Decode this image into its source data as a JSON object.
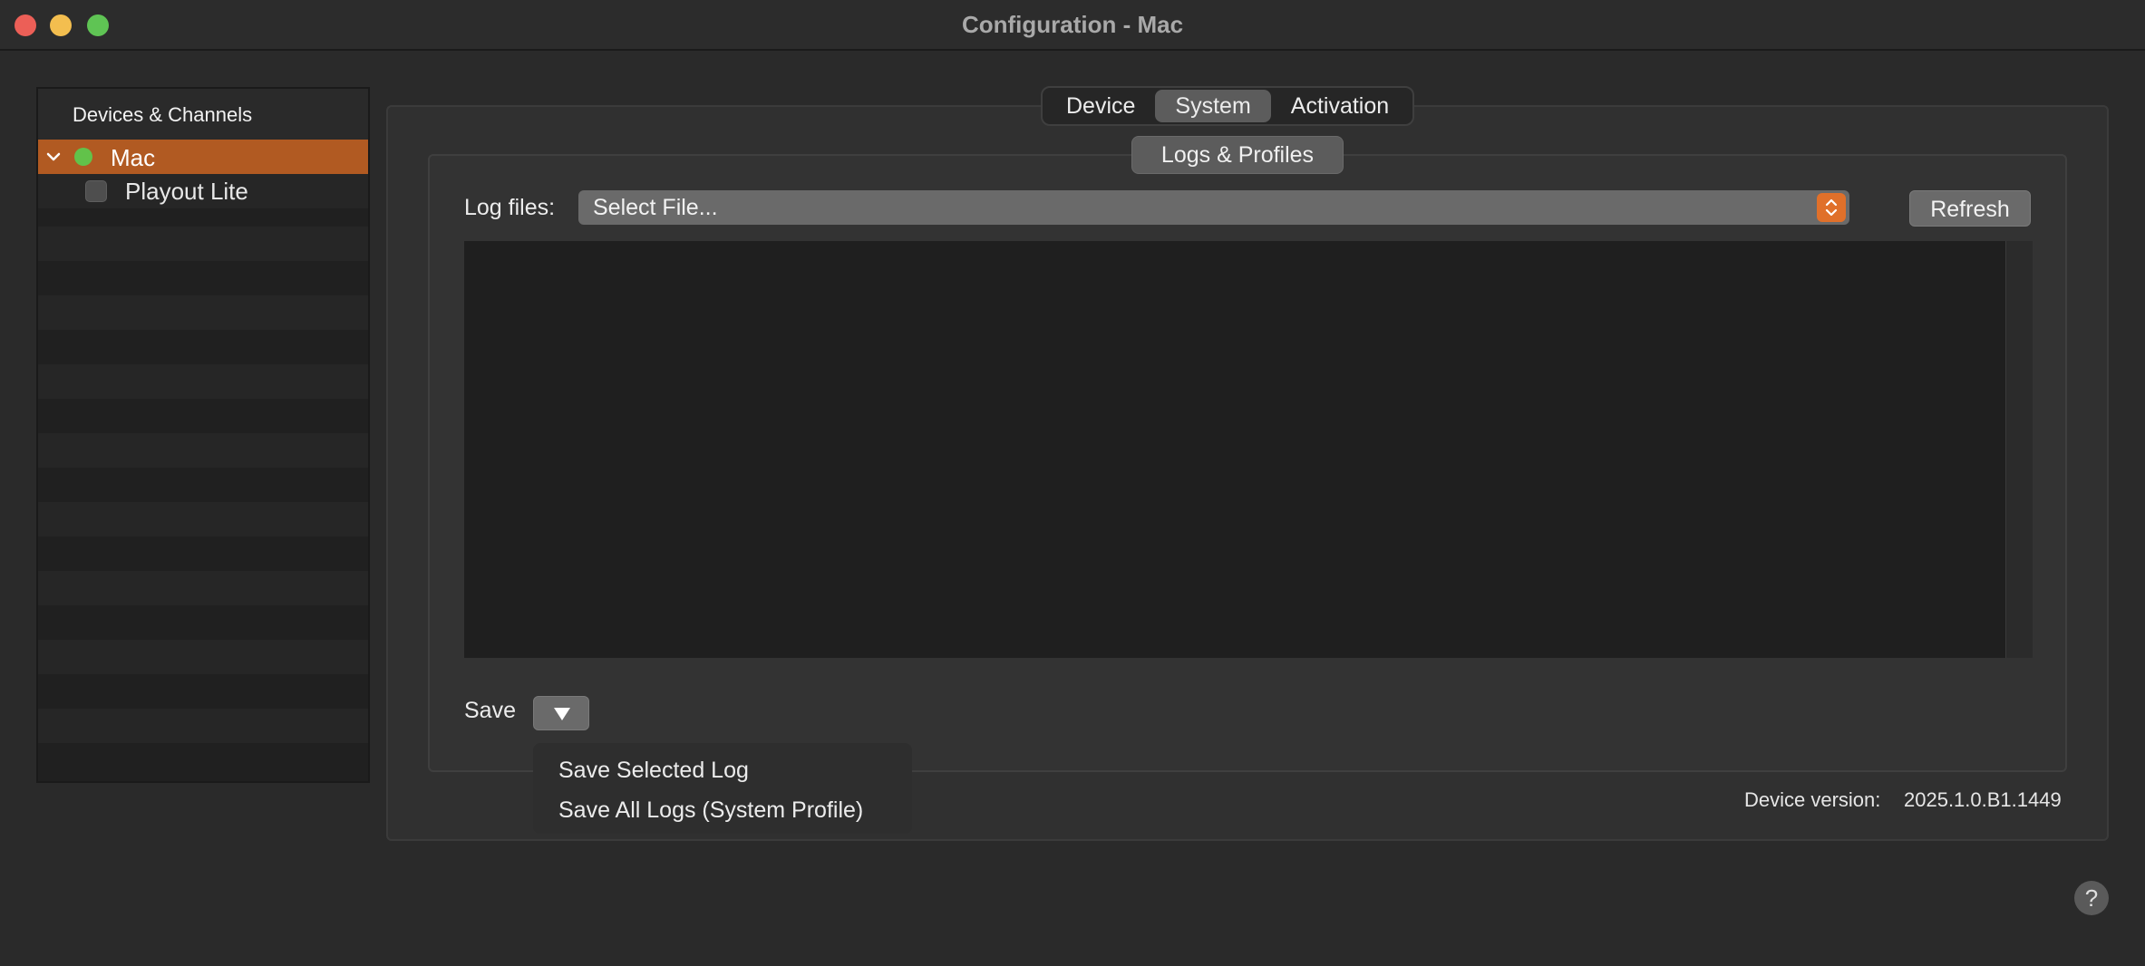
{
  "window": {
    "title": "Configuration - Mac"
  },
  "sidebar": {
    "header": "Devices & Channels",
    "items": [
      {
        "label": "Mac",
        "status_color": "#62c24a",
        "selected": true
      },
      {
        "label": "Playout Lite",
        "checked": false
      }
    ]
  },
  "tabs": [
    {
      "label": "Device",
      "active": false
    },
    {
      "label": "System",
      "active": true
    },
    {
      "label": "Activation",
      "active": false
    }
  ],
  "section": {
    "title": "Logs & Profiles"
  },
  "log_files": {
    "label": "Log files:",
    "selected": "Select File..."
  },
  "refresh_label": "Refresh",
  "save": {
    "label": "Save",
    "menu": [
      "Save Selected Log",
      "Save All Logs (System Profile)"
    ]
  },
  "device_version": {
    "label": "Device version:",
    "value": "2025.1.0.B1.1449"
  },
  "help_label": "?",
  "colors": {
    "accent": "#b15a22",
    "accent_bright": "#e0702a",
    "status_green": "#62c24a"
  }
}
